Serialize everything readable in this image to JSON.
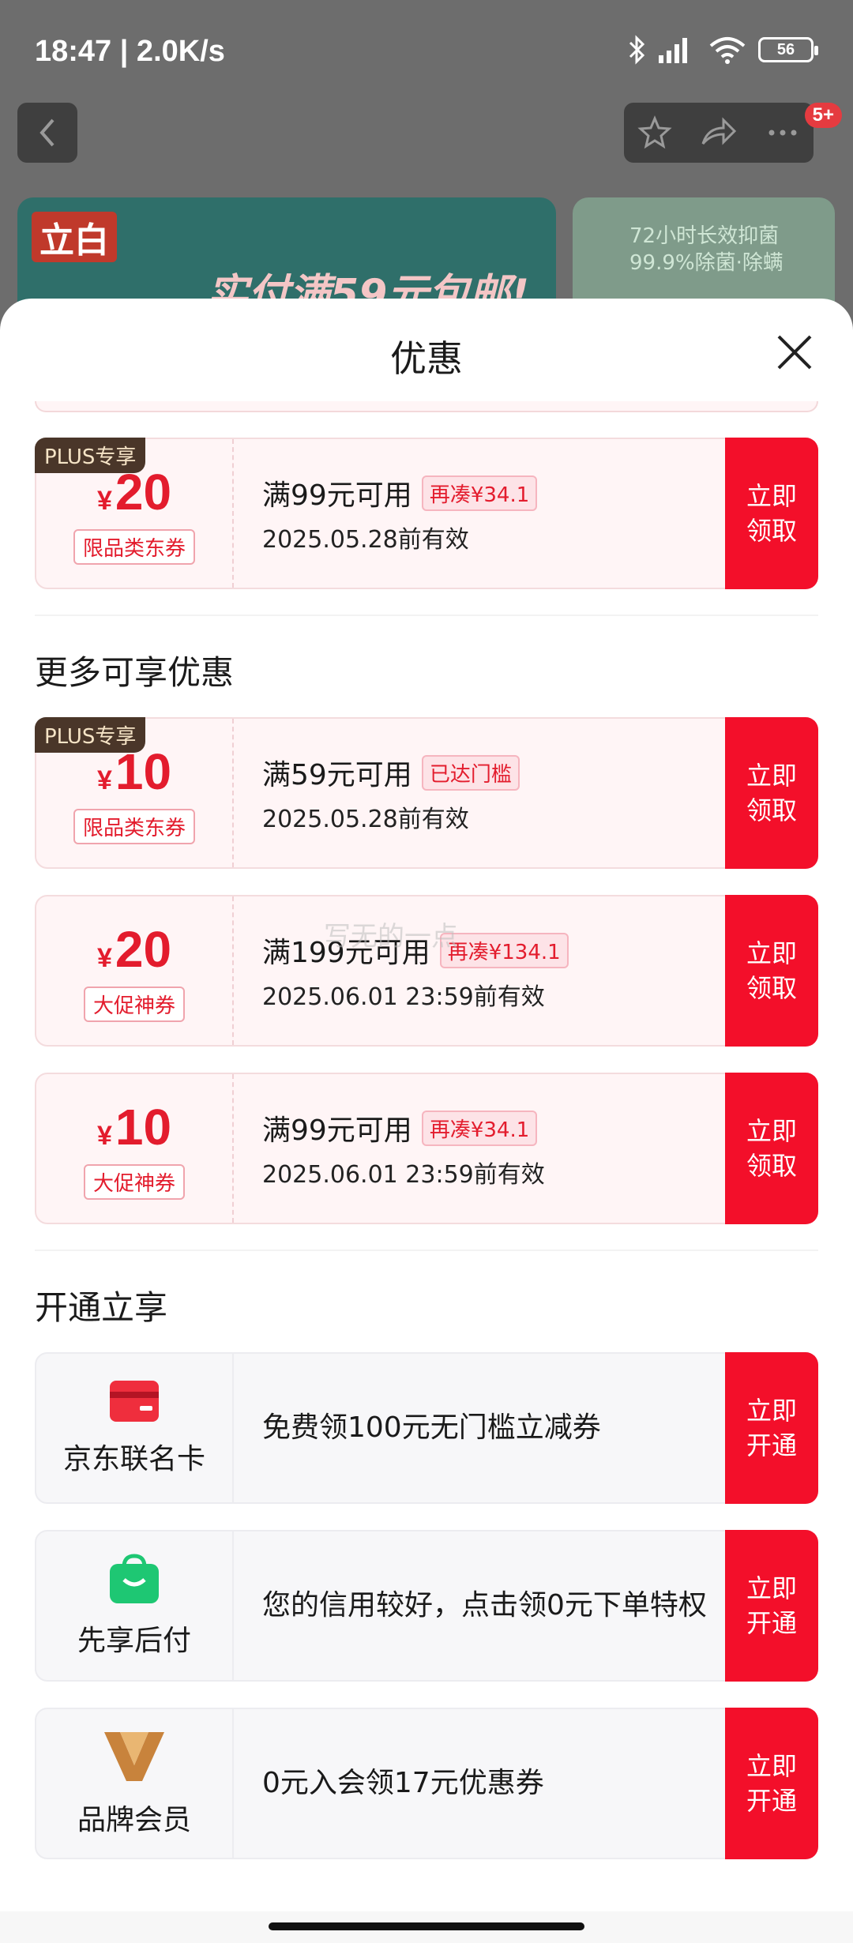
{
  "status_bar": {
    "time": "18:47 | 2.0K/s",
    "battery": "56"
  },
  "top_nav": {
    "badge": "5+"
  },
  "background": {
    "banner1_logo": "立白",
    "banner1_slogan": "实付满59元包邮!",
    "banner2_line1": "72小时长效抑菌",
    "banner2_line2": "99.9%除菌·除螨"
  },
  "sheet": {
    "title": "优惠"
  },
  "colors": {
    "accent_red": "#f30f2a",
    "price_red": "#e31c2d",
    "plus_dark": "#4a3629"
  },
  "coupons_top": [
    {
      "plus": "PLUS专享",
      "currency": "¥",
      "amount": "20",
      "type": "限品类东券",
      "condition": "满99元可用",
      "chip": "再凑¥34.1",
      "expiry": "2025.05.28前有效",
      "button": [
        "立即",
        "领取"
      ]
    }
  ],
  "more_section": {
    "title": "更多可享优惠",
    "coupons": [
      {
        "plus": "PLUS专享",
        "currency": "¥",
        "amount": "10",
        "type": "限品类东券",
        "condition": "满59元可用",
        "chip": "已达门槛",
        "expiry": "2025.05.28前有效",
        "button": [
          "立即",
          "领取"
        ]
      },
      {
        "currency": "¥",
        "amount": "20",
        "type": "大促神券",
        "condition": "满199元可用",
        "chip": "再凑¥134.1",
        "expiry": "2025.06.01 23:59前有效",
        "button": [
          "立即",
          "领取"
        ]
      },
      {
        "currency": "¥",
        "amount": "10",
        "type": "大促神券",
        "condition": "满99元可用",
        "chip": "再凑¥34.1",
        "expiry": "2025.06.01 23:59前有效",
        "button": [
          "立即",
          "领取"
        ]
      }
    ]
  },
  "watermark": "写无的一点",
  "open_section": {
    "title": "开通立享",
    "items": [
      {
        "icon": "credit-card-icon",
        "name": "京东联名卡",
        "text": "免费领100元无门槛立减券",
        "button": [
          "立即",
          "开通"
        ]
      },
      {
        "icon": "shopping-bag-icon",
        "name": "先享后付",
        "text": "您的信用较好，点击领0元下单特权",
        "button": [
          "立即",
          "开通"
        ]
      },
      {
        "icon": "v-logo-icon",
        "name": "品牌会员",
        "text": "0元入会领17元优惠券",
        "button": [
          "立即",
          "开通"
        ]
      }
    ]
  }
}
